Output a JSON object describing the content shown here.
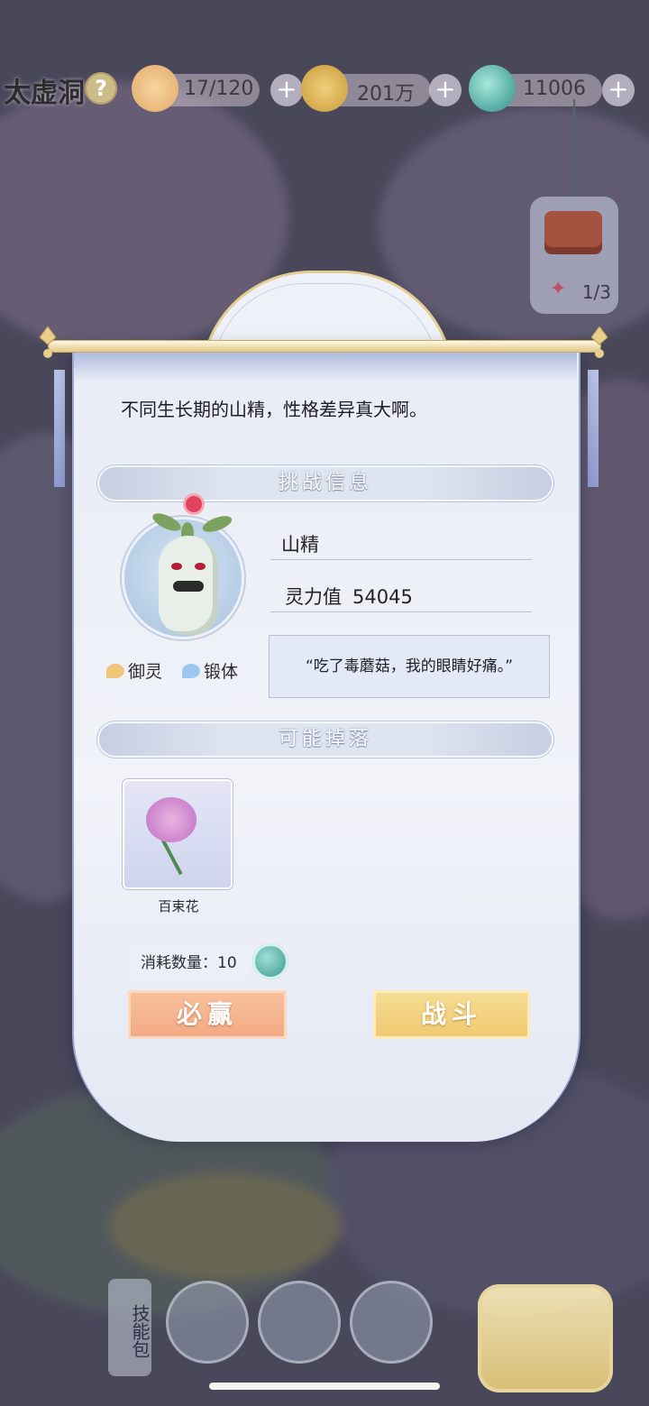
{
  "hud": {
    "location": "太虚洞",
    "help_icon": "?",
    "stamina": "17/120",
    "coins": "201万",
    "spirit": "11006",
    "plus": "+"
  },
  "side_reward": {
    "count": "1/3"
  },
  "dialog": {
    "description": "不同生长期的山精，性格差异真大啊。",
    "section_challenge": "挑战信息",
    "enemy_name": "山精",
    "power_label": "灵力值",
    "power_value": "54045",
    "trait_1": "御灵",
    "trait_2": "锻体",
    "quote": "“吃了毒蘑菇，我的眼睛好痛。”",
    "section_drops": "可能掉落",
    "drop_item": "百束花",
    "cost_label": "消耗数量：10",
    "btn_win": "必赢",
    "btn_fight": "战斗"
  },
  "bottom": {
    "skill_pack": "技能包"
  },
  "colors": {
    "accent_gold": "#e4cf93",
    "panel_border": "#9aa7cf",
    "btn_win": "#f2a882",
    "btn_fight": "#f0c96f"
  }
}
